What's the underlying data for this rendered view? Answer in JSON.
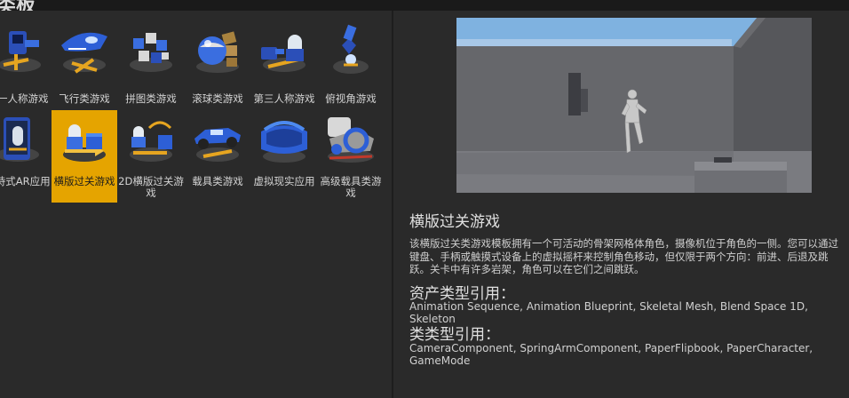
{
  "window": {
    "title": "类板"
  },
  "templates": [
    {
      "label": "第一人称游戏",
      "icon": "first-person-icon"
    },
    {
      "label": "飞行类游戏",
      "icon": "flying-icon"
    },
    {
      "label": "拼图类游戏",
      "icon": "puzzle-icon"
    },
    {
      "label": "滚球类游戏",
      "icon": "rolling-icon"
    },
    {
      "label": "第三人称游戏",
      "icon": "third-person-icon"
    },
    {
      "label": "俯视角游戏",
      "icon": "top-down-icon"
    },
    {
      "label": "手持式AR应用",
      "icon": "handheld-ar-icon"
    },
    {
      "label": "横版过关游戏",
      "icon": "side-scroller-icon",
      "selected": true
    },
    {
      "label": "2D横版过关游戏",
      "icon": "2d-side-scroller-icon"
    },
    {
      "label": "载具类游戏",
      "icon": "vehicle-icon"
    },
    {
      "label": "虚拟现实应用",
      "icon": "vr-icon"
    },
    {
      "label": "高级载具类游戏",
      "icon": "advanced-vehicle-icon"
    }
  ],
  "details": {
    "title": "横版过关游戏",
    "description": "该横版过关类游戏模板拥有一个可活动的骨架网格体角色，摄像机位于角色的一侧。您可以通过\n键盘、手柄或触摸式设备上的虚拟摇杆来控制角色移动，但仅限于两个方向：前进、后退及跳\n跃。关卡中有许多岩架，角色可以在它们之间跳跃。",
    "asset_types_heading": "资产类型引用：",
    "asset_types": "Animation Sequence, Animation Blueprint, Skeletal Mesh, Blend Space 1D, Skeleton",
    "class_types_heading": "类类型引用：",
    "class_types": "CameraComponent, SpringArmComponent, PaperFlipbook, PaperCharacter, GameMode"
  },
  "colors": {
    "selected": "#e5a400",
    "panel": "#2a2a2a",
    "sky": "#7fb2e0"
  }
}
